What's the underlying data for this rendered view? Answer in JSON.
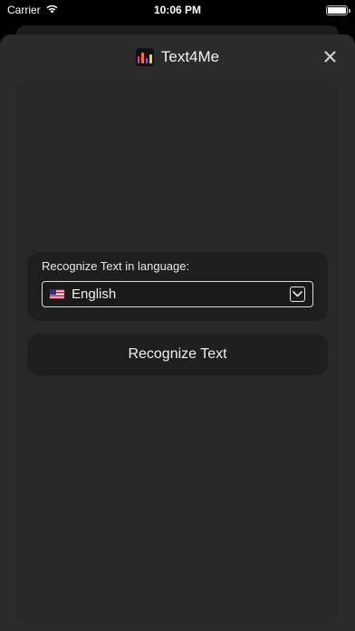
{
  "status_bar": {
    "carrier": "Carrier",
    "time": "10:06 PM",
    "wifi_icon": "wifi-icon",
    "battery_icon": "battery-icon",
    "battery_level": 1.0
  },
  "nav": {
    "title": "Text4Me",
    "app_icon": "text4me-app-icon",
    "close_icon": "close-icon"
  },
  "language_card": {
    "label": "Recognize Text in language:",
    "selected_language": "English",
    "flag_icon": "us-flag-icon",
    "chevron_icon": "chevron-down-icon"
  },
  "actions": {
    "recognize_label": "Recognize Text"
  },
  "colors": {
    "background": "#000000",
    "sheet": "#2b2b2b",
    "card": "#1e1e1e",
    "text": "#f0f0f0"
  }
}
